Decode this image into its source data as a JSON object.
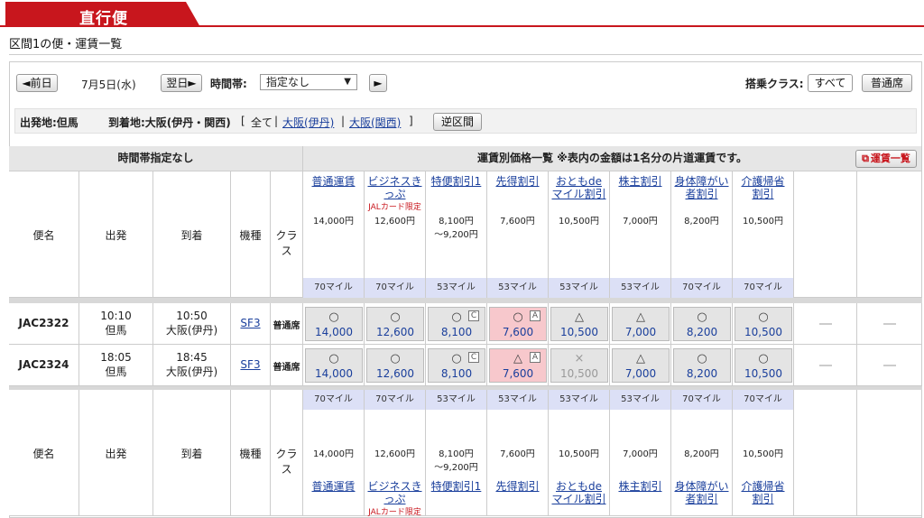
{
  "tab": {
    "title": "直行便"
  },
  "subtitle": "区間1の便・運賃一覧",
  "toolbar": {
    "prev_label": "◄前日",
    "date": "7月5日(水)",
    "next_label": "翌日►",
    "time_label": "時間帯:",
    "time_value": "指定なし",
    "go_label": "►",
    "class_label": "搭乗クラス:",
    "class_all": "すべて",
    "class_regular": "普通席"
  },
  "route": {
    "origin": "出発地:但馬",
    "dest_label": "到着地:大阪(伊丹・関西)",
    "bracket_open": "[",
    "all": "全て",
    "sep1": "|",
    "itami": "大阪(伊丹)",
    "sep2": "|",
    "kansai": "大阪(関西)",
    "bracket_close": "]",
    "reverse_label": "逆区間"
  },
  "table": {
    "time_header": "時間帯指定なし",
    "fare_header": "運賃別価格一覧 ※表内の金額は1名分の片道運賃です。",
    "fare_list_btn": "運賃一覧",
    "columns": {
      "flight": "便名",
      "depart": "出発",
      "arrive": "到着",
      "aircraft": "機種",
      "class": "クラス"
    },
    "fares": [
      {
        "name1": "普通運賃",
        "name2": "",
        "sub": "",
        "price": "14,000円",
        "price2": "",
        "mile": "70マイル"
      },
      {
        "name1": "ビジネスきっぷ",
        "name2": "",
        "sub": "JALカード限定",
        "price": "12,600円",
        "price2": "",
        "mile": "70マイル"
      },
      {
        "name1": "特便割引1",
        "name2": "",
        "sub": "",
        "price": "8,100円",
        "price2": "～9,200円",
        "mile": "53マイル"
      },
      {
        "name1": "先得割引",
        "name2": "",
        "sub": "",
        "price": "7,600円",
        "price2": "",
        "mile": "53マイル"
      },
      {
        "name1": "おともde",
        "name2": "マイル割引",
        "sub": "",
        "price": "10,500円",
        "price2": "",
        "mile": "53マイル"
      },
      {
        "name1": "株主割引",
        "name2": "",
        "sub": "",
        "price": "7,000円",
        "price2": "",
        "mile": "53マイル"
      },
      {
        "name1": "身体障がい",
        "name2": "者割引",
        "sub": "",
        "price": "8,200円",
        "price2": "",
        "mile": "70マイル"
      },
      {
        "name1": "介護帰省",
        "name2": "割引",
        "sub": "",
        "price": "10,500円",
        "price2": "",
        "mile": "70マイル"
      }
    ],
    "flights": [
      {
        "no": "JAC2322",
        "dep_time": "10:10",
        "dep_place": "但馬",
        "arr_time": "10:50",
        "arr_place": "大阪(伊丹)",
        "aircraft": "SF3",
        "class": "普通席",
        "cells": [
          {
            "mark": "○",
            "amount": "14,000"
          },
          {
            "mark": "○",
            "amount": "12,600"
          },
          {
            "mark": "○",
            "amount": "8,100",
            "badge": "C"
          },
          {
            "mark": "○",
            "amount": "7,600",
            "badge": "A"
          },
          {
            "mark": "△",
            "amount": "10,500"
          },
          {
            "mark": "△",
            "amount": "7,000"
          },
          {
            "mark": "○",
            "amount": "8,200"
          },
          {
            "mark": "○",
            "amount": "10,500"
          }
        ]
      },
      {
        "no": "JAC2324",
        "dep_time": "18:05",
        "dep_place": "但馬",
        "arr_time": "18:45",
        "arr_place": "大阪(伊丹)",
        "aircraft": "SF3",
        "class": "普通席",
        "cells": [
          {
            "mark": "○",
            "amount": "14,000"
          },
          {
            "mark": "○",
            "amount": "12,600"
          },
          {
            "mark": "○",
            "amount": "8,100",
            "badge": "C"
          },
          {
            "mark": "△",
            "amount": "7,600",
            "badge": "A"
          },
          {
            "mark": "×",
            "amount": "10,500"
          },
          {
            "mark": "△",
            "amount": "7,000"
          },
          {
            "mark": "○",
            "amount": "8,200"
          },
          {
            "mark": "○",
            "amount": "10,500"
          }
        ]
      }
    ],
    "dash": "—"
  }
}
